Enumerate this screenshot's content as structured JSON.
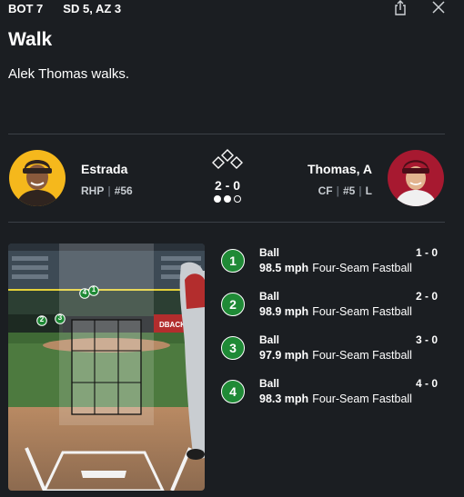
{
  "header": {
    "inning": "BOT 7",
    "score": "SD 5, AZ 3",
    "share_icon": "share-icon",
    "close_icon": "close-icon"
  },
  "play": {
    "title": "Walk",
    "description": "Alek Thomas walks."
  },
  "pitcher": {
    "name": "Estrada",
    "hand": "RHP",
    "number": "#56",
    "team_color": "#f5b81c"
  },
  "batter": {
    "name": "Thomas, A",
    "position": "CF",
    "number": "#5",
    "bats": "L",
    "team_color": "#a71930"
  },
  "count": {
    "balls_strikes": "2 - 0",
    "outs_icon": "outs-dots",
    "outs_filled": 2,
    "outs_total": 3,
    "bases_icon": "bases-diamond-icon"
  },
  "field_markers": [
    "4",
    "1",
    "2",
    "3"
  ],
  "pitches": [
    {
      "num": "1",
      "result": "Ball",
      "count": "1 - 0",
      "speed": "98.5 mph",
      "type": "Four-Seam Fastball"
    },
    {
      "num": "2",
      "result": "Ball",
      "count": "2 - 0",
      "speed": "98.9 mph",
      "type": "Four-Seam Fastball"
    },
    {
      "num": "3",
      "result": "Ball",
      "count": "3 - 0",
      "speed": "97.9 mph",
      "type": "Four-Seam Fastball"
    },
    {
      "num": "4",
      "result": "Ball",
      "count": "4 - 0",
      "speed": "98.3 mph",
      "type": "Four-Seam Fastball"
    }
  ],
  "colors": {
    "background": "#1b1e22",
    "pitch_badge": "#1f8a36"
  }
}
